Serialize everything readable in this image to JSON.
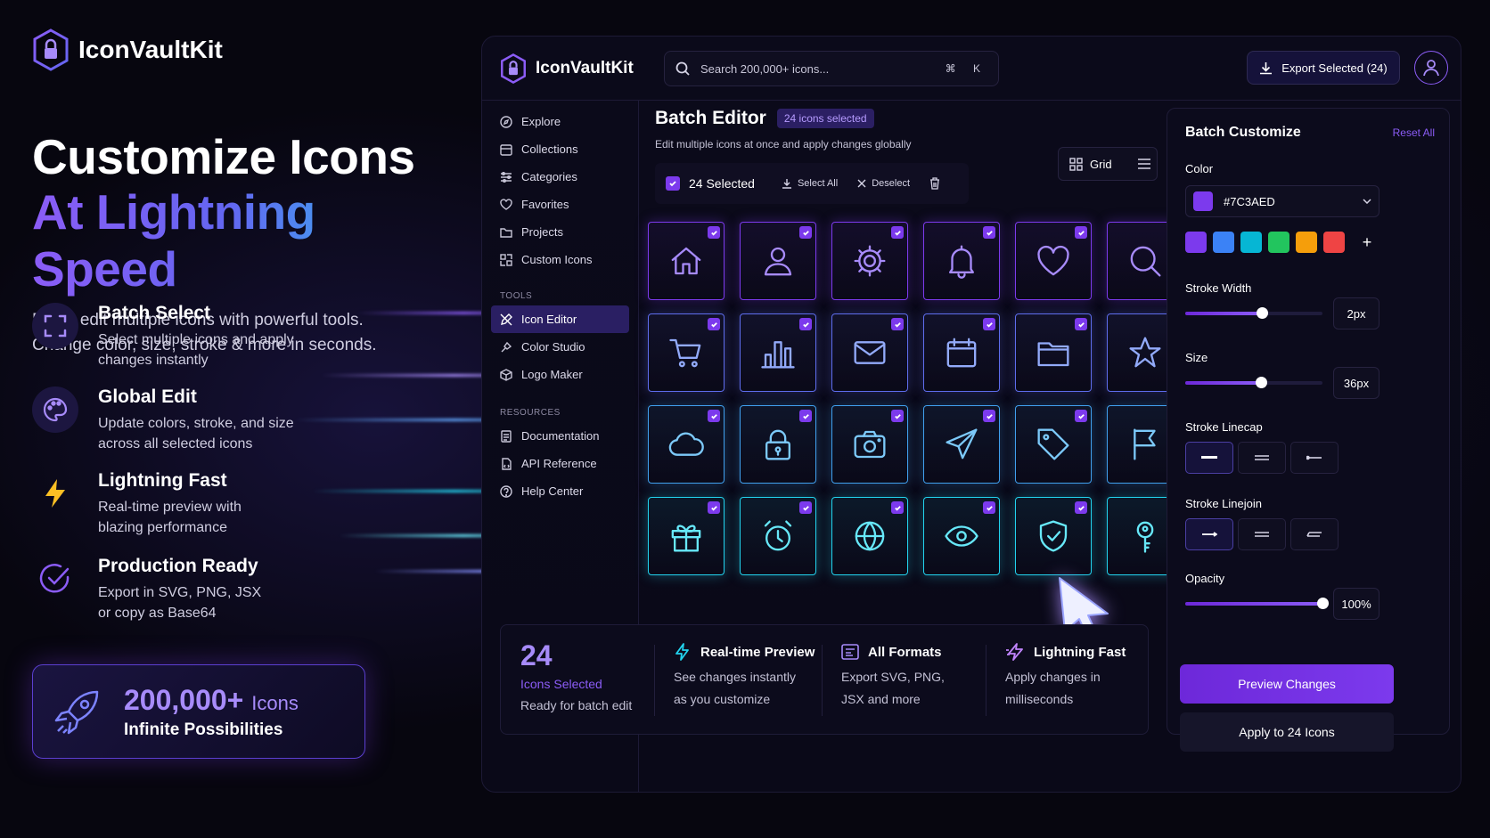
{
  "brand": {
    "name": "IconVaultKit"
  },
  "hero": {
    "line1": "Customize Icons",
    "line2": "At Lightning Speed",
    "subtitle1": "Batch edit multiple icons with powerful tools.",
    "subtitle2": "Change color, size, stroke & more in seconds."
  },
  "features": [
    {
      "title": "Batch Select",
      "line1": "Select multiple icons and apply",
      "line2": "changes instantly",
      "icon": "select-frame-icon"
    },
    {
      "title": "Global Edit",
      "line1": "Update colors, stroke, and size",
      "line2": "across all selected icons",
      "icon": "palette-icon"
    },
    {
      "title": "Lightning Fast",
      "line1": "Real-time preview with",
      "line2": "blazing performance",
      "icon": "lightning-icon"
    },
    {
      "title": "Production Ready",
      "line1": "Export in SVG, PNG, JSX",
      "line2": "or copy as Base64",
      "icon": "check-circle-icon"
    }
  ],
  "stat": {
    "number": "200,000+",
    "unit": "Icons",
    "label": "Infinite Possibilities"
  },
  "app": {
    "brand": "IconVaultKit",
    "search_placeholder": "Search 200,000+ icons...",
    "search_shortcut": "⌘ K",
    "export_label": "Export Selected (24)",
    "sidebar": {
      "items": [
        {
          "label": "Explore",
          "icon": "compass-icon"
        },
        {
          "label": "Collections",
          "icon": "calendar-icon"
        },
        {
          "label": "Categories",
          "icon": "categories-icon"
        },
        {
          "label": "Favorites",
          "icon": "heart-icon"
        },
        {
          "label": "Projects",
          "icon": "folder-icon"
        },
        {
          "label": "Custom Icons",
          "icon": "custom-icon"
        }
      ],
      "tools_heading": "TOOLS",
      "tools": [
        {
          "label": "Icon Editor",
          "icon": "pen-icon",
          "active": true
        },
        {
          "label": "Color Studio",
          "icon": "palette-icon"
        },
        {
          "label": "Logo Maker",
          "icon": "cube-icon"
        }
      ],
      "resources_heading": "RESOURCES",
      "resources": [
        {
          "label": "Documentation",
          "icon": "doc-icon"
        },
        {
          "label": "API Reference",
          "icon": "code-icon"
        },
        {
          "label": "Help Center",
          "icon": "help-icon"
        }
      ]
    },
    "editor": {
      "title": "Batch Editor",
      "badge": "24 icons selected",
      "description": "Edit multiple icons at once and apply changes globally",
      "view_label": "Grid",
      "selected_label": "24 Selected",
      "select_all": "Select All",
      "deselect": "Deselect",
      "icons": [
        "home",
        "user",
        "gear",
        "bell",
        "heart",
        "search",
        "cart",
        "chart",
        "mail",
        "calendar",
        "folder",
        "star",
        "cloud",
        "lock",
        "camera",
        "send",
        "tag",
        "flag",
        "gift",
        "alarm",
        "globe",
        "eye",
        "shield",
        "key"
      ]
    },
    "info": {
      "count": "24",
      "count_label": "Icons Selected",
      "count_sub": "Ready for batch edit",
      "items": [
        {
          "title": "Real-time Preview",
          "line1": "See changes instantly",
          "line2": "as you customize",
          "icon": "bolt-icon"
        },
        {
          "title": "All Formats",
          "line1": "Export SVG, PNG,",
          "line2": "JSX and more",
          "icon": "formats-icon"
        },
        {
          "title": "Lightning Fast",
          "line1": "Apply changes in",
          "line2": "milliseconds",
          "icon": "zap-icon"
        }
      ]
    },
    "panel": {
      "title": "Batch Customize",
      "reset": "Reset All",
      "color_label": "Color",
      "color_value": "#7C3AED",
      "swatches": [
        "#7c3aed",
        "#3b82f6",
        "#06b6d4",
        "#22c55e",
        "#f59e0b",
        "#ef4444"
      ],
      "stroke_width_label": "Stroke Width",
      "stroke_width_value": "2px",
      "stroke_width_fraction": 0.56,
      "size_label": "Size",
      "size_value": "36px",
      "size_fraction": 0.55,
      "linecap_label": "Stroke Linecap",
      "linejoin_label": "Stroke Linejoin",
      "opacity_label": "Opacity",
      "opacity_value": "100%",
      "opacity_fraction": 1.0,
      "preview_button": "Preview Changes",
      "apply_button": "Apply to 24 Icons"
    }
  },
  "colors": {
    "accent": "#7c3aed",
    "accent_light": "#a78bfa",
    "cyan": "#22d3ee"
  }
}
